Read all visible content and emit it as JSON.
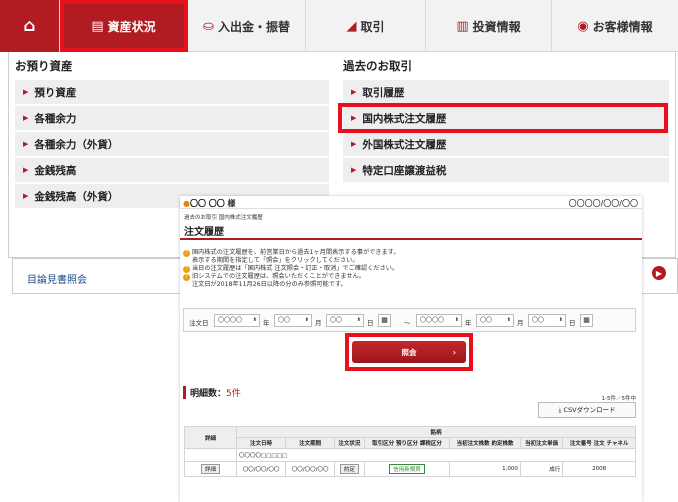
{
  "nav": {
    "home_icon": "home-icon",
    "items": [
      {
        "label": "資産状況",
        "icon": "asset-icon"
      },
      {
        "label": "入出金・振替",
        "icon": "deposit-icon"
      },
      {
        "label": "取引",
        "icon": "trade-icon"
      },
      {
        "label": "投資情報",
        "icon": "chart-icon"
      },
      {
        "label": "お客様情報",
        "icon": "user-icon"
      }
    ],
    "active_color": "#b01c22"
  },
  "menu": {
    "left_heading": "お預り資産",
    "left_items": [
      "預り資産",
      "各種余力",
      "各種余力（外貨）",
      "金銭残高",
      "金銭残高（外貨）"
    ],
    "right_heading": "過去のお取引",
    "right_items": [
      "取引履歴",
      "国内株式注文履歴",
      "外国株式注文履歴",
      "特定口座譲渡益税"
    ]
  },
  "background_strip": {
    "label": "目論見書照会"
  },
  "panel": {
    "user": "〇〇 〇〇 様",
    "date": "〇〇〇〇/〇〇/〇〇",
    "breadcrumb": "過去のお取引 国内株式注文履歴",
    "title": "注文履歴",
    "notes": [
      "国内株式の注文履歴を、前営業日から過去1ヶ月間表示する事ができます。",
      "表示する期間を指定して「照会」をクリックしてください。",
      "当日の注文履歴は「国内株式 注文照会・訂正・取消」でご確認ください。",
      "旧システムでの注文履歴は、照会いただくことができません。",
      "注文日が2018年11月26日以降の分のみ参照可能です。"
    ],
    "date_filter": {
      "label": "注文日",
      "year_label": "年",
      "month_label": "月",
      "day_label": "日",
      "tilde": "～",
      "from_year": "〇〇〇〇",
      "from_month": "〇〇",
      "from_day": "〇〇",
      "to_year": "〇〇〇〇",
      "to_month": "〇〇",
      "to_day": "〇〇"
    },
    "refer_button": "照会",
    "count_label": "明細数：",
    "count_value": "5件",
    "paging": "1-5件／5件中",
    "csv_button": "⤓ CSVダウンロード",
    "table": {
      "col_detail": "詳細",
      "col_brand": "銘柄",
      "col_order_date": "注文日時",
      "col_period": "注文期間",
      "col_status": "注文状況",
      "col_trade_type": "取引区分 預り区分 課税区分",
      "col_initial_qty": "当初注文株数 約定株数",
      "col_initial_price": "当初注文単価",
      "col_order_no": "注文番号 注文 チャネル",
      "row1_brand": "〇〇〇〇□□□□□",
      "row1_detail": "詳細",
      "row1_order_date": "〇〇/〇〇/〇〇",
      "row1_period": "〇〇/〇〇/〇〇",
      "row1_status": "約定",
      "row1_trade_type": "信用新規買",
      "row1_qty": "1,000",
      "row1_price": "成行",
      "row1_no": "2008"
    }
  },
  "highlight_color": "#e8101b"
}
